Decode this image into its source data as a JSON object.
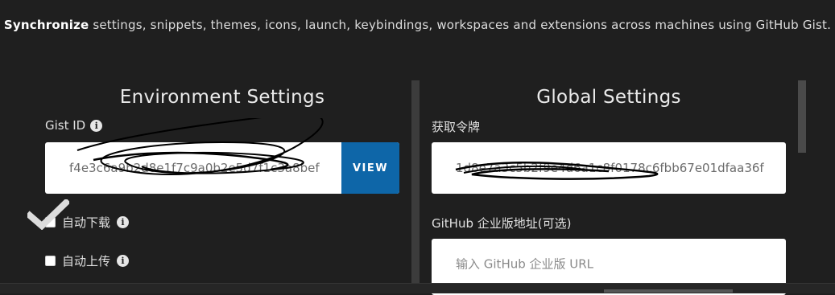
{
  "intro": {
    "bold": "Synchronize",
    "text": " settings, snippets, themes, icons, launch, keybindings, workspaces and extensions across machines using GitHub Gist."
  },
  "environment": {
    "heading": "Environment Settings",
    "gist_label": "Gist ID",
    "gist_value": "f4e3c6a9b2d8e1f7c9a0b2e5d7f1c3a8bef",
    "view_button": "VIEW",
    "auto_download": "自动下载",
    "auto_upload": "自动上传",
    "auto_download_checked": true,
    "auto_upload_checked": false
  },
  "global": {
    "heading": "Global Settings",
    "token_label": "获取令牌",
    "token_value": "1d8e7a3c5b2f9e4d6a1c8f0178c6fbb67e01dfaa36f",
    "enterprise_label": "GitHub 企业版地址(可选)",
    "enterprise_placeholder": "输入 GitHub 企业版 URL"
  },
  "icons": {
    "info": "info-icon",
    "check": "checkmark-icon"
  },
  "colors": {
    "background": "#1f1f1f",
    "accent": "#0e66a8",
    "input_bg": "#ffffff"
  }
}
